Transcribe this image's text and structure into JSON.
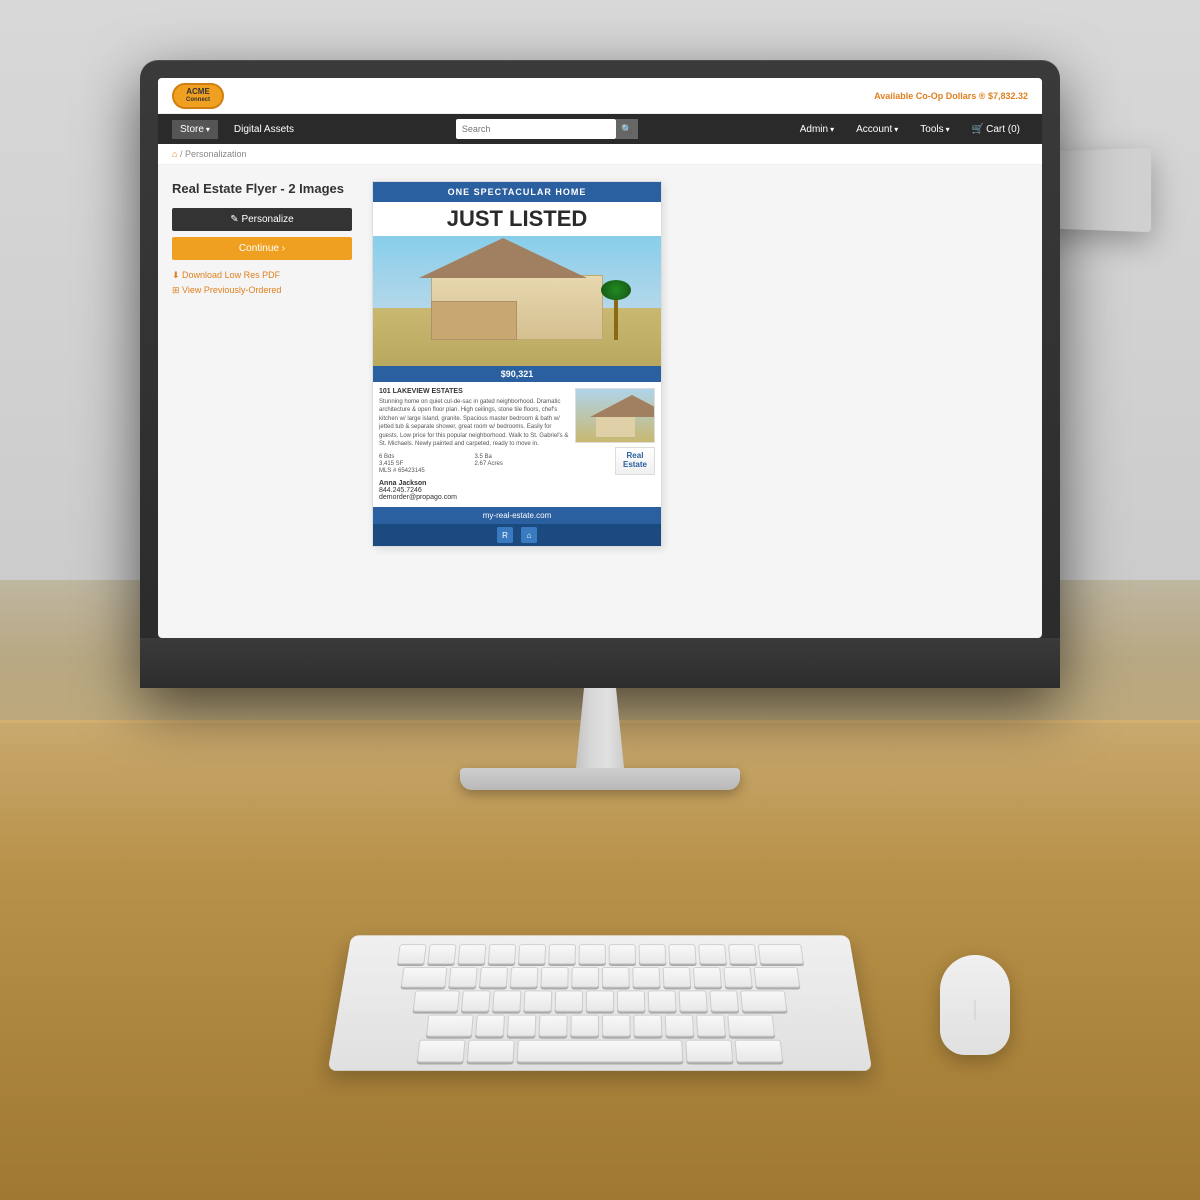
{
  "page": {
    "title": "Real Estate Flyer - 2 Images"
  },
  "site": {
    "logo_line1": "ACME",
    "logo_line2": "Connect",
    "co_op_label": "Available Co-Op Dollars ®",
    "co_op_value": "$7,832.32"
  },
  "navbar": {
    "store_label": "Store",
    "digital_assets_label": "Digital Assets",
    "search_placeholder": "Search",
    "admin_label": "Admin",
    "account_label": "Account",
    "tools_label": "Tools",
    "cart_label": "Cart (0)"
  },
  "breadcrumb": {
    "home": "⌂",
    "separator": "/",
    "current": "Personalization"
  },
  "product": {
    "title": "Real Estate Flyer - 2 Images",
    "personalize_btn": "✎ Personalize",
    "continue_btn": "Continue ›",
    "download_link": "⬇ Download Low Res PDF",
    "view_link": "⊞ View Previously-Ordered"
  },
  "flyer": {
    "header_text": "ONE SPECTACULAR HOME",
    "title": "JUST LISTED",
    "price": "$90,321",
    "address": "101 LAKEVIEW ESTATES",
    "description": "Stunning home on quiet cul-de-sac in gated neighborhood. Dramatic architecture & open floor plan. High ceilings, stone tile floors, chef's kitchen w/ large island, granite. Spacious master bedroom & bath w/ jetted tub & separate shower, great room w/ bedrooms. Easily for guests. Low price for this popular neighborhood. Walk to St. Gabriel's & St. Michaels. Newly painted and carpeted, ready to move in.",
    "beds": "6 Bds",
    "baths": "3.5 Ba",
    "sqft": "3,415 SF",
    "acres": "2.67 Acres",
    "mls": "MLS # 65423145",
    "agent_name": "Anna Jackson",
    "agent_phone": "844.245.7246",
    "agent_email": "demorder@propago.com",
    "logo_text": "Real\nEstate",
    "website": "my-real-estate.com",
    "footer_icon1": "R",
    "footer_icon2": "⌂"
  }
}
